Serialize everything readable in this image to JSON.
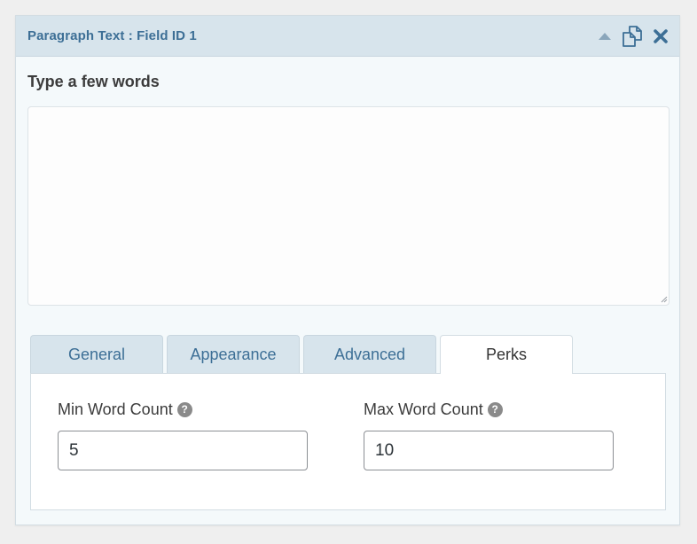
{
  "header": {
    "title": "Paragraph Text : Field ID 1",
    "icons": [
      "collapse-arrow-icon",
      "duplicate-icon",
      "delete-icon"
    ]
  },
  "field": {
    "label": "Type a few words",
    "value": ""
  },
  "tabs": [
    {
      "label": "General",
      "active": false
    },
    {
      "label": "Appearance",
      "active": false
    },
    {
      "label": "Advanced",
      "active": false
    },
    {
      "label": "Perks",
      "active": true
    }
  ],
  "perks": {
    "min_label": "Min Word Count",
    "min_value": "5",
    "max_label": "Max Word Count",
    "max_value": "10",
    "help_glyph": "?"
  },
  "colors": {
    "header_bg": "#d7e4ec",
    "title": "#3d6f96",
    "icon": "#3d6f96"
  }
}
